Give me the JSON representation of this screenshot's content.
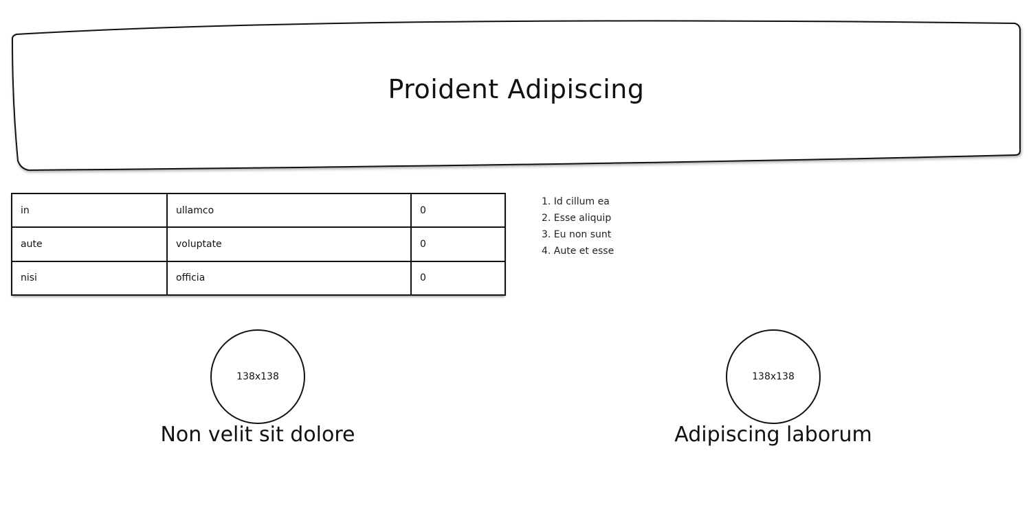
{
  "banner": {
    "title": "Proident Adipiscing"
  },
  "table": {
    "rows": [
      [
        "in",
        "ullamco",
        "0"
      ],
      [
        "aute",
        "voluptate",
        "0"
      ],
      [
        "nisi",
        "officia",
        "0"
      ]
    ]
  },
  "list": {
    "items": [
      "1. Id cillum ea",
      "2. Esse aliquip",
      "3. Eu non sunt",
      "4. Aute et esse"
    ]
  },
  "cards": [
    {
      "image_label": "138x138",
      "caption": "Non velit sit dolore"
    },
    {
      "image_label": "138x138",
      "caption": "Adipiscing laborum"
    }
  ]
}
